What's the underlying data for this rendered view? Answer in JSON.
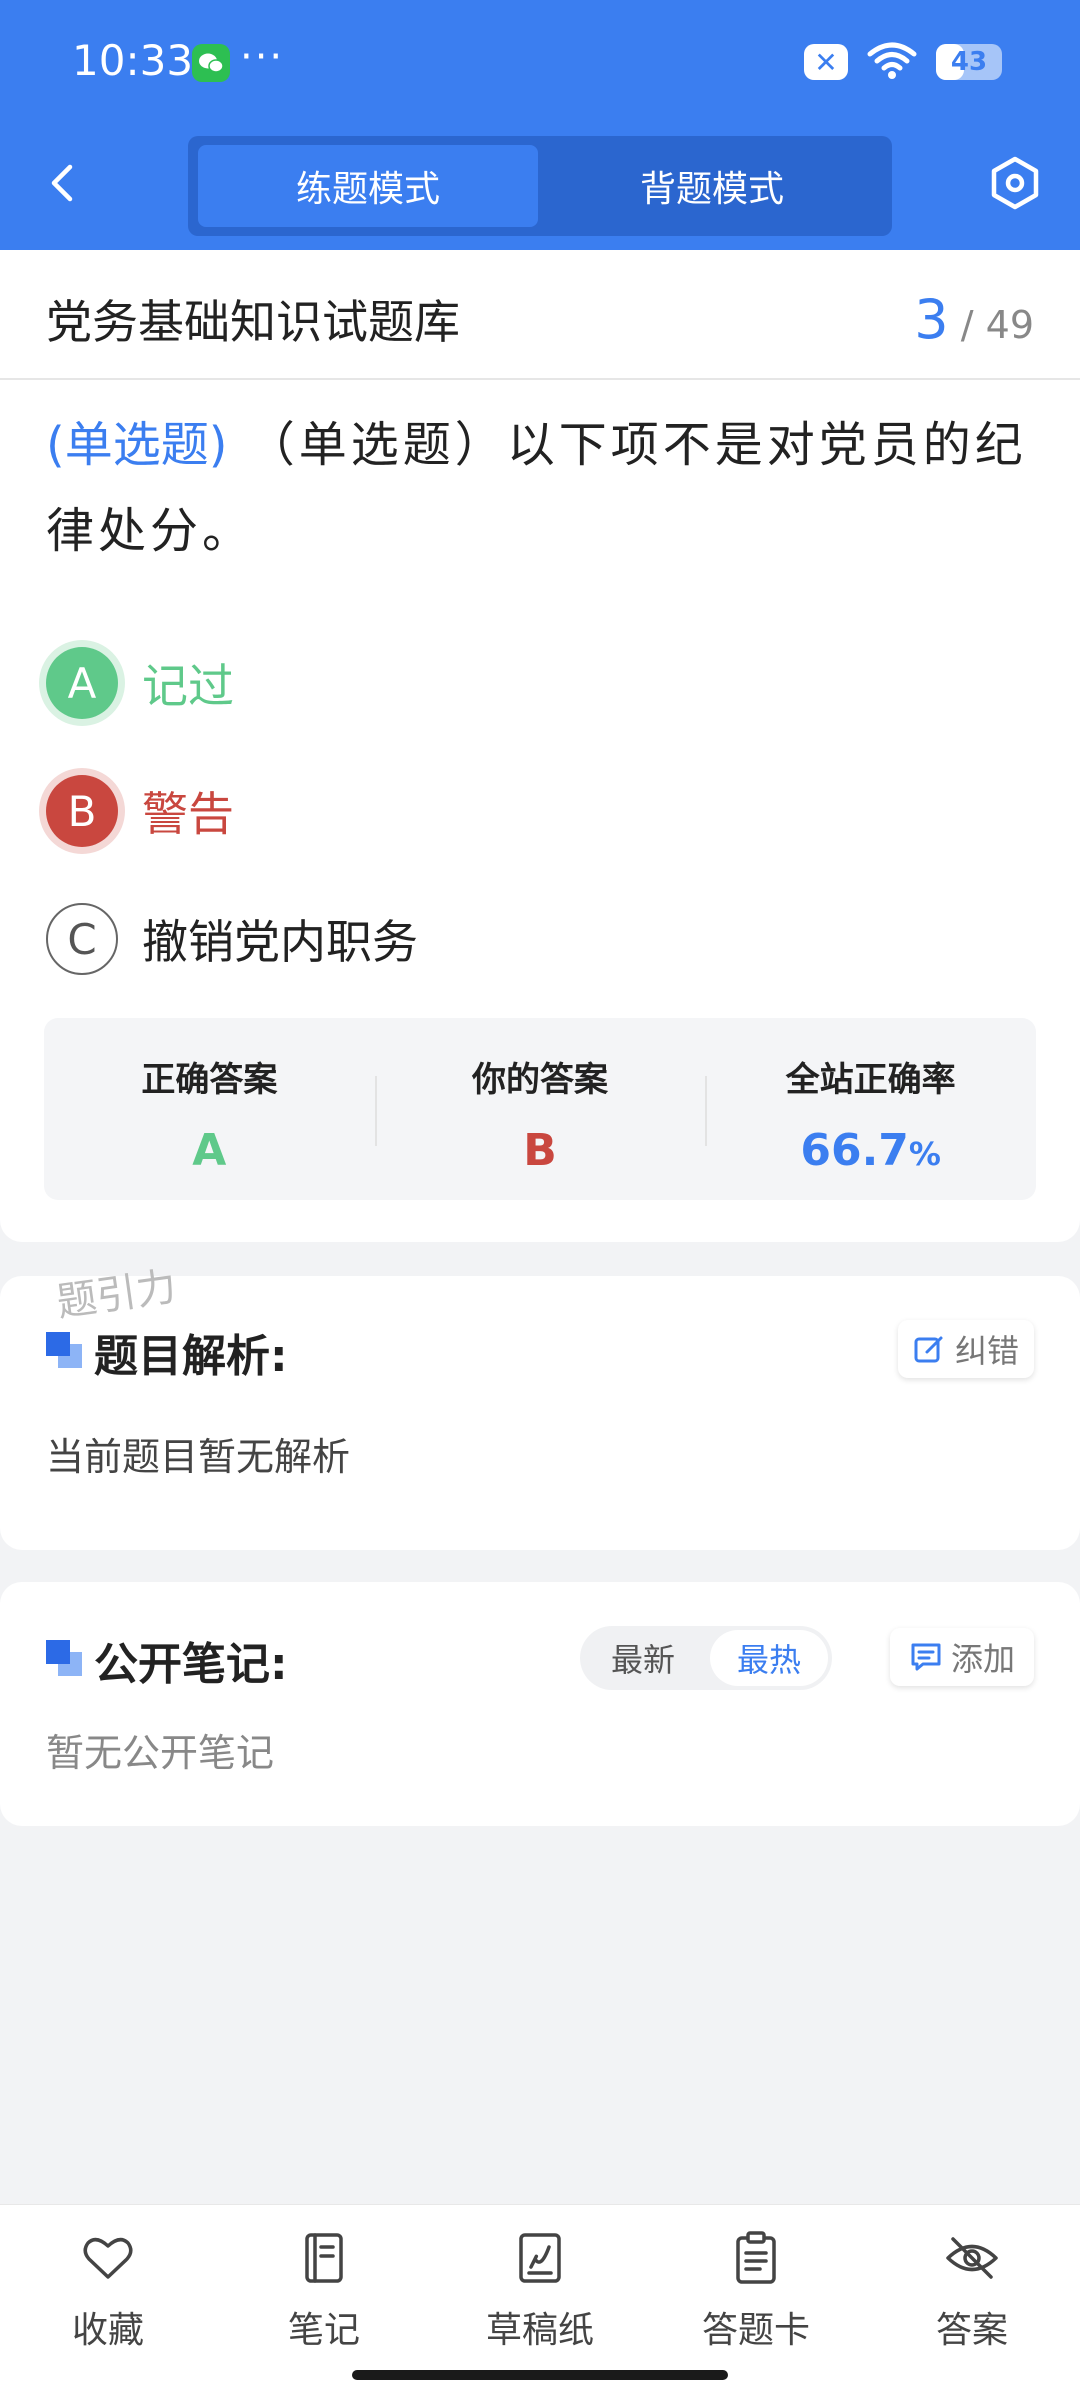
{
  "status_bar": {
    "time": "10:33",
    "more": "···",
    "battery": "43",
    "battery_level": 0.43
  },
  "header": {
    "tabs": [
      {
        "label": "练题模式",
        "active": true
      },
      {
        "label": "背题模式",
        "active": false
      }
    ]
  },
  "quiz": {
    "bank_title": "党务基础知识试题库",
    "current": "3",
    "total": "49",
    "question_tag": "(单选题)",
    "question_text": "（单选题）以下项不是对党员的纪律处分。",
    "options": [
      {
        "letter": "A",
        "text": "记过",
        "state": "correct"
      },
      {
        "letter": "B",
        "text": "警告",
        "state": "wrong"
      },
      {
        "letter": "C",
        "text": "撤销党内职务",
        "state": "normal"
      }
    ],
    "stats": {
      "correct_label": "正确答案",
      "correct_value": "A",
      "yours_label": "你的答案",
      "yours_value": "B",
      "rate_label": "全站正确率",
      "rate_value": "66.7",
      "rate_unit": "%"
    }
  },
  "analysis": {
    "watermark": "题引力",
    "title": "题目解析:",
    "report_label": "纠错",
    "empty_text": "当前题目暂无解析"
  },
  "notes": {
    "title": "公开笔记:",
    "sort_latest": "最新",
    "sort_hot": "最热",
    "add_label": "添加",
    "empty_text": "暂无公开笔记"
  },
  "bottom_nav": [
    {
      "label": "收藏",
      "icon": "heart-icon"
    },
    {
      "label": "笔记",
      "icon": "notebook-icon"
    },
    {
      "label": "草稿纸",
      "icon": "draft-icon"
    },
    {
      "label": "答题卡",
      "icon": "clipboard-icon"
    },
    {
      "label": "答案",
      "icon": "eye-off-icon"
    }
  ],
  "colors": {
    "primary": "#3b7ef0",
    "correct": "#5fc98a",
    "wrong": "#c9473f"
  }
}
